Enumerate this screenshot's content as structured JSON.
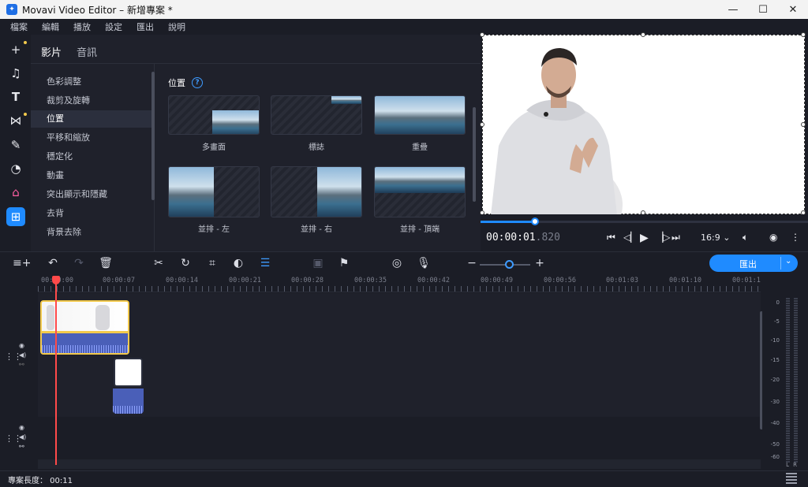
{
  "window": {
    "title": "Movavi Video Editor – 新增專案 *",
    "minimize": "—",
    "maximize": "☐",
    "close": "✕"
  },
  "menu": [
    "檔案",
    "編輯",
    "播放",
    "設定",
    "匯出",
    "說明"
  ],
  "left_tools": [
    "plus-icon",
    "music-icon",
    "text-icon",
    "transitions-icon",
    "magic-wand-icon",
    "clock-icon",
    "gift-icon",
    "filters-icon"
  ],
  "panel": {
    "tabs": [
      "影片",
      "音訊"
    ],
    "categories": [
      "色彩調整",
      "裁剪及旋轉",
      "位置",
      "平移和縮放",
      "穩定化",
      "動畫",
      "突出顯示和隱藏",
      "去背",
      "背景去除"
    ],
    "selected_category": "位置",
    "section_title": "位置",
    "help": "?",
    "presets": [
      "多畫面",
      "標誌",
      "重疊",
      "並排 - 左",
      "並排 - 右",
      "並排 - 頂端"
    ]
  },
  "player": {
    "timecode_main": "00:00:01",
    "timecode_ms": ".820",
    "progress": 0.17,
    "aspect_ratio": "16:9",
    "aspect_arrow": "⌄"
  },
  "toolbar": {
    "export_label": "匯出",
    "export_arrow": "⌄",
    "zoom_minus": "−",
    "zoom_plus": "+"
  },
  "timeline": {
    "ruler": [
      "00:00:00",
      "00:00:07",
      "00:00:14",
      "00:00:21",
      "00:00:28",
      "00:00:35",
      "00:00:42",
      "00:00:49",
      "00:00:56",
      "00:01:03",
      "00:01:10",
      "00:01:1"
    ],
    "meter_labels": [
      "0",
      "-5",
      "-10",
      "-15",
      "-20",
      "-30",
      "-40",
      "-50",
      "-60"
    ],
    "meter_channels": [
      "L",
      "R"
    ]
  },
  "status": {
    "project_length": "專案長度： 00:11"
  },
  "colors": {
    "accent": "#1f8bff",
    "playhead": "#ff4a4a",
    "clip_border": "#f2c94c",
    "audio_wave": "#4a5fb8"
  }
}
